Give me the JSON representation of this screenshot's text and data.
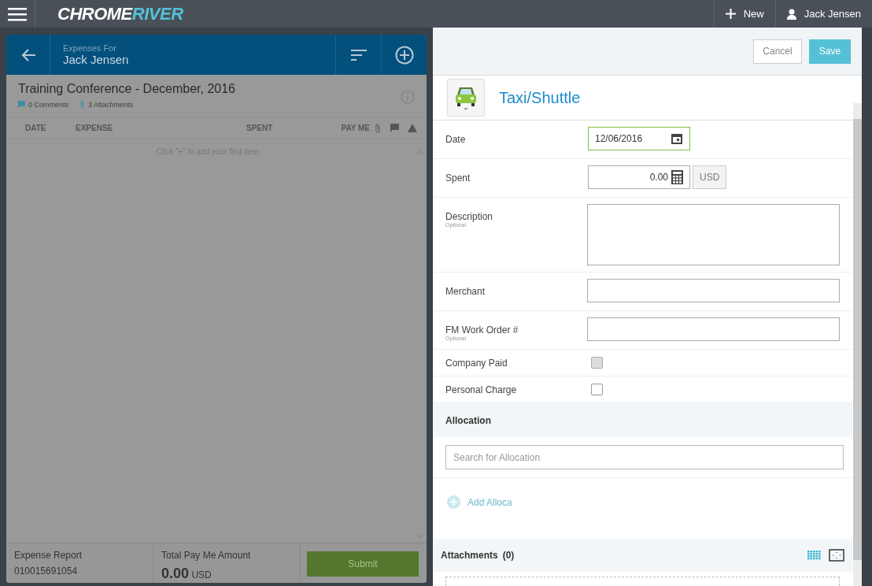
{
  "top_bar": {
    "logo": {
      "first": "CHROME",
      "second": "RIVER"
    },
    "new_label": "New",
    "user": "Jack Jensen"
  },
  "report_panel": {
    "header_caption": "Expenses For",
    "header_name": "Jack Jensen",
    "title": "Training Conference - December, 2016",
    "comments": "0 Comments",
    "attachments": "3 Attachments",
    "columns": [
      "DATE",
      "EXPENSE",
      "SPENT",
      "PAY ME"
    ],
    "empty_hint": "Click \"+\" to add your first item.",
    "footer": {
      "report_label": "Expense Report",
      "report_number": "010015691054",
      "total_label": "Total Pay Me Amount",
      "total": "0.00",
      "currency": "USD",
      "submit": "Submit"
    }
  },
  "expense_form": {
    "cancel": "Cancel",
    "save": "Save",
    "expense_type": "Taxi/Shuttle",
    "fields": [
      {
        "label": "Date",
        "kind": "date",
        "value": "12/06/2016",
        "focused": true
      },
      {
        "label": "Spent",
        "kind": "amount",
        "value": "0.00",
        "currency": "USD",
        "focused": false
      },
      {
        "label": "Description",
        "hint": "Optional",
        "kind": "textarea",
        "focused": false
      },
      {
        "label": "Merchant",
        "kind": "text",
        "focused": false
      },
      {
        "label": "FM Work Order #",
        "hint": "Optional",
        "kind": "text",
        "focused": false
      },
      {
        "label": "Company Paid",
        "kind": "checkbox",
        "checked": false,
        "disabled": true
      },
      {
        "label": "Personal Charge",
        "kind": "checkbox",
        "checked": false,
        "disabled": false
      }
    ],
    "allocation": {
      "title": "Allocation",
      "placeholder": "Search for Allocation",
      "add_label": "Add Alloca"
    },
    "attachments": {
      "title": "Attachments",
      "count": "(0)"
    }
  }
}
